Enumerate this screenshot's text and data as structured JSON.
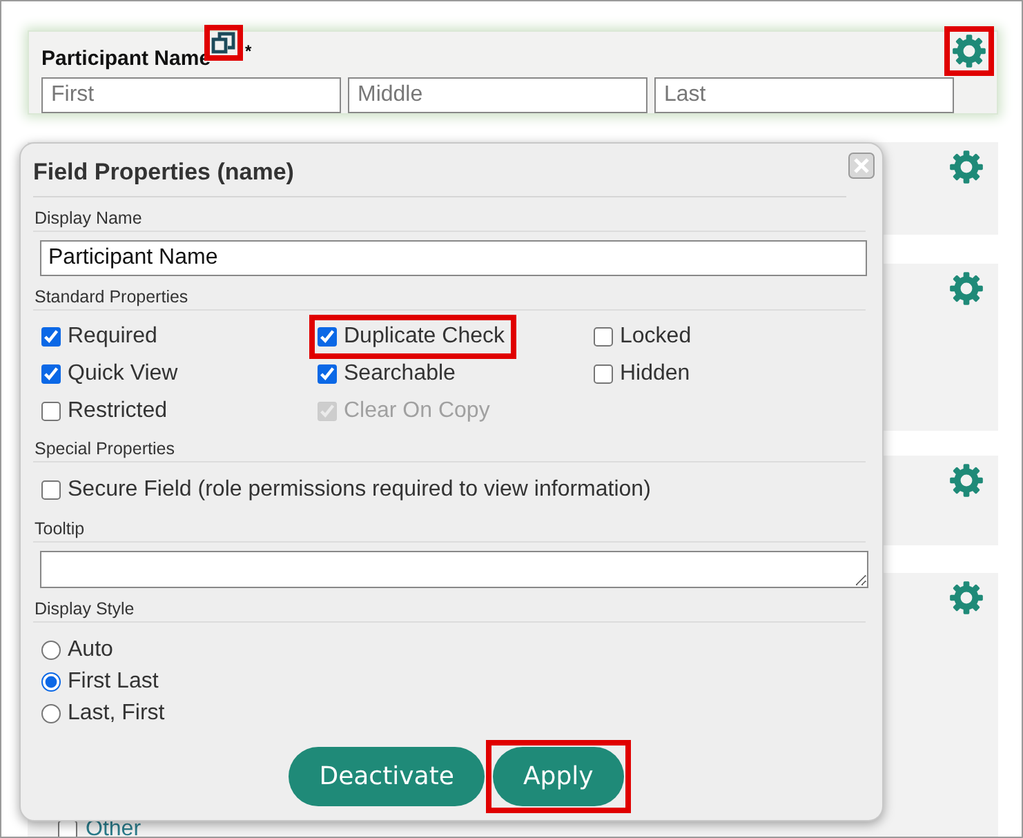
{
  "field_card": {
    "label": "Participant Name",
    "required_mark": "*",
    "copy_icon_highlighted": true,
    "gear_highlighted": true,
    "inputs": [
      {
        "placeholder": "First"
      },
      {
        "placeholder": "Middle"
      },
      {
        "placeholder": "Last"
      }
    ]
  },
  "background_cards": [
    {
      "kind": "empty"
    },
    {
      "kind": "empty"
    },
    {
      "kind": "empty"
    },
    {
      "kind": "option",
      "option": {
        "label": "Other",
        "checked": false
      }
    }
  ],
  "dialog": {
    "title": "Field Properties (name)",
    "display_name": {
      "label": "Display Name",
      "value": "Participant Name"
    },
    "standard_properties": {
      "label": "Standard Properties",
      "options": [
        {
          "label": "Required",
          "checked": true,
          "disabled": false,
          "highlighted": false
        },
        {
          "label": "Duplicate Check",
          "checked": true,
          "disabled": false,
          "highlighted": true
        },
        {
          "label": "Locked",
          "checked": false,
          "disabled": false,
          "highlighted": false
        },
        {
          "label": "Quick View",
          "checked": true,
          "disabled": false,
          "highlighted": false
        },
        {
          "label": "Searchable",
          "checked": true,
          "disabled": false,
          "highlighted": false
        },
        {
          "label": "Hidden",
          "checked": false,
          "disabled": false,
          "highlighted": false
        },
        {
          "label": "Restricted",
          "checked": false,
          "disabled": false,
          "highlighted": false
        },
        {
          "label": "Clear On Copy",
          "checked": true,
          "disabled": true,
          "highlighted": false
        }
      ]
    },
    "special_properties": {
      "label": "Special Properties",
      "options": [
        {
          "label": "Secure Field (role permissions required to view information)",
          "checked": false
        }
      ]
    },
    "tooltip": {
      "label": "Tooltip"
    },
    "display_style": {
      "label": "Display Style",
      "options": [
        {
          "label": "Auto",
          "selected": false
        },
        {
          "label": "First Last",
          "selected": true
        },
        {
          "label": "Last, First",
          "selected": false
        }
      ]
    },
    "buttons": [
      {
        "label": "Deactivate",
        "highlighted": false
      },
      {
        "label": "Apply",
        "highlighted": true
      }
    ]
  }
}
